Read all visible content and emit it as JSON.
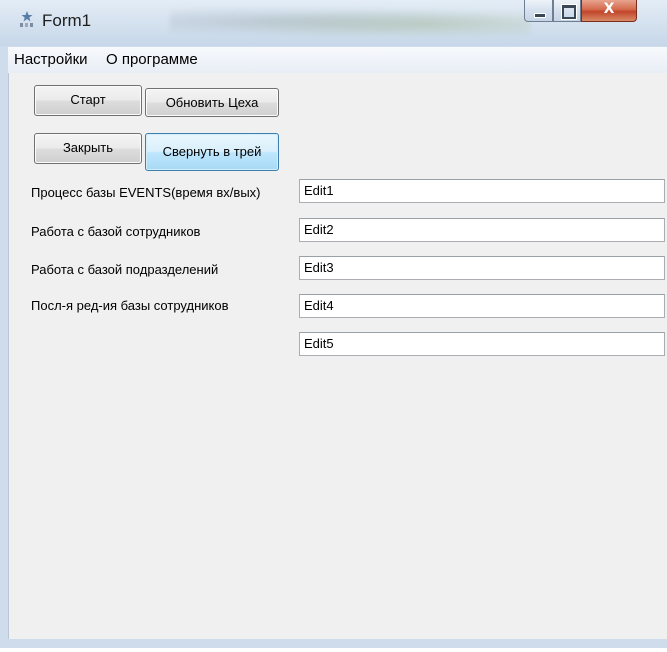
{
  "window": {
    "title": "Form1"
  },
  "titlebar_buttons": {
    "minimize_glyph": "",
    "maximize_glyph": "",
    "close_glyph": "X"
  },
  "menu": {
    "items": [
      "Настройки",
      "О программе"
    ]
  },
  "buttons": {
    "start": "Старт",
    "refresh_shops": "Обновить Цеха",
    "close": "Закрыть",
    "minimize_to_tray": "Свернуть в трей"
  },
  "rows": [
    {
      "label": "Процесс базы EVENTS(время вх/вых)",
      "value": "Edit1"
    },
    {
      "label": "Работа с базой сотрудников",
      "value": "Edit2"
    },
    {
      "label": "Работа с базой подразделений",
      "value": "Edit3"
    },
    {
      "label": "Посл-я ред-ия базы сотрудников",
      "value": "Edit4"
    },
    {
      "label": "",
      "value": "Edit5"
    }
  ],
  "colors": {
    "titlebar": "#d3e0ee",
    "client_bg": "#f0f0f0",
    "close_button": "#c2452b",
    "focused_button": "#bee6fd"
  },
  "icons": {
    "app": "app-icon",
    "minimize": "minimize-icon",
    "maximize": "maximize-icon",
    "close": "close-icon"
  }
}
